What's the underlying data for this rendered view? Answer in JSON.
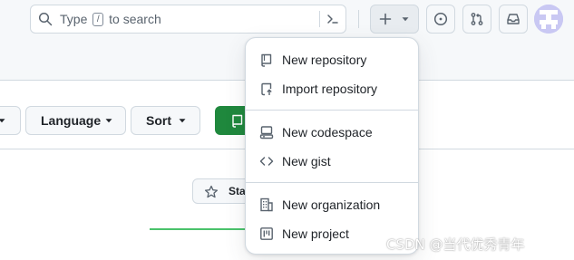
{
  "header": {
    "search": {
      "prefix": "Type",
      "key": "/",
      "suffix": "to search"
    }
  },
  "create_menu": {
    "items": [
      {
        "label": "New repository",
        "icon": "repo-icon"
      },
      {
        "label": "Import repository",
        "icon": "repo-push-icon"
      },
      {
        "label": "New codespace",
        "icon": "codespaces-icon"
      },
      {
        "label": "New gist",
        "icon": "code-icon"
      },
      {
        "label": "New organization",
        "icon": "organization-icon"
      },
      {
        "label": "New project",
        "icon": "project-icon"
      }
    ]
  },
  "filters": {
    "language_label": "Language",
    "sort_label": "Sort"
  },
  "star_button": {
    "label": "Star"
  },
  "watermark": "CSDN @当代优秀青年",
  "colors": {
    "accent_green": "#1f883d",
    "border": "#d1d9e0",
    "header_bg": "#f6f8fa"
  }
}
